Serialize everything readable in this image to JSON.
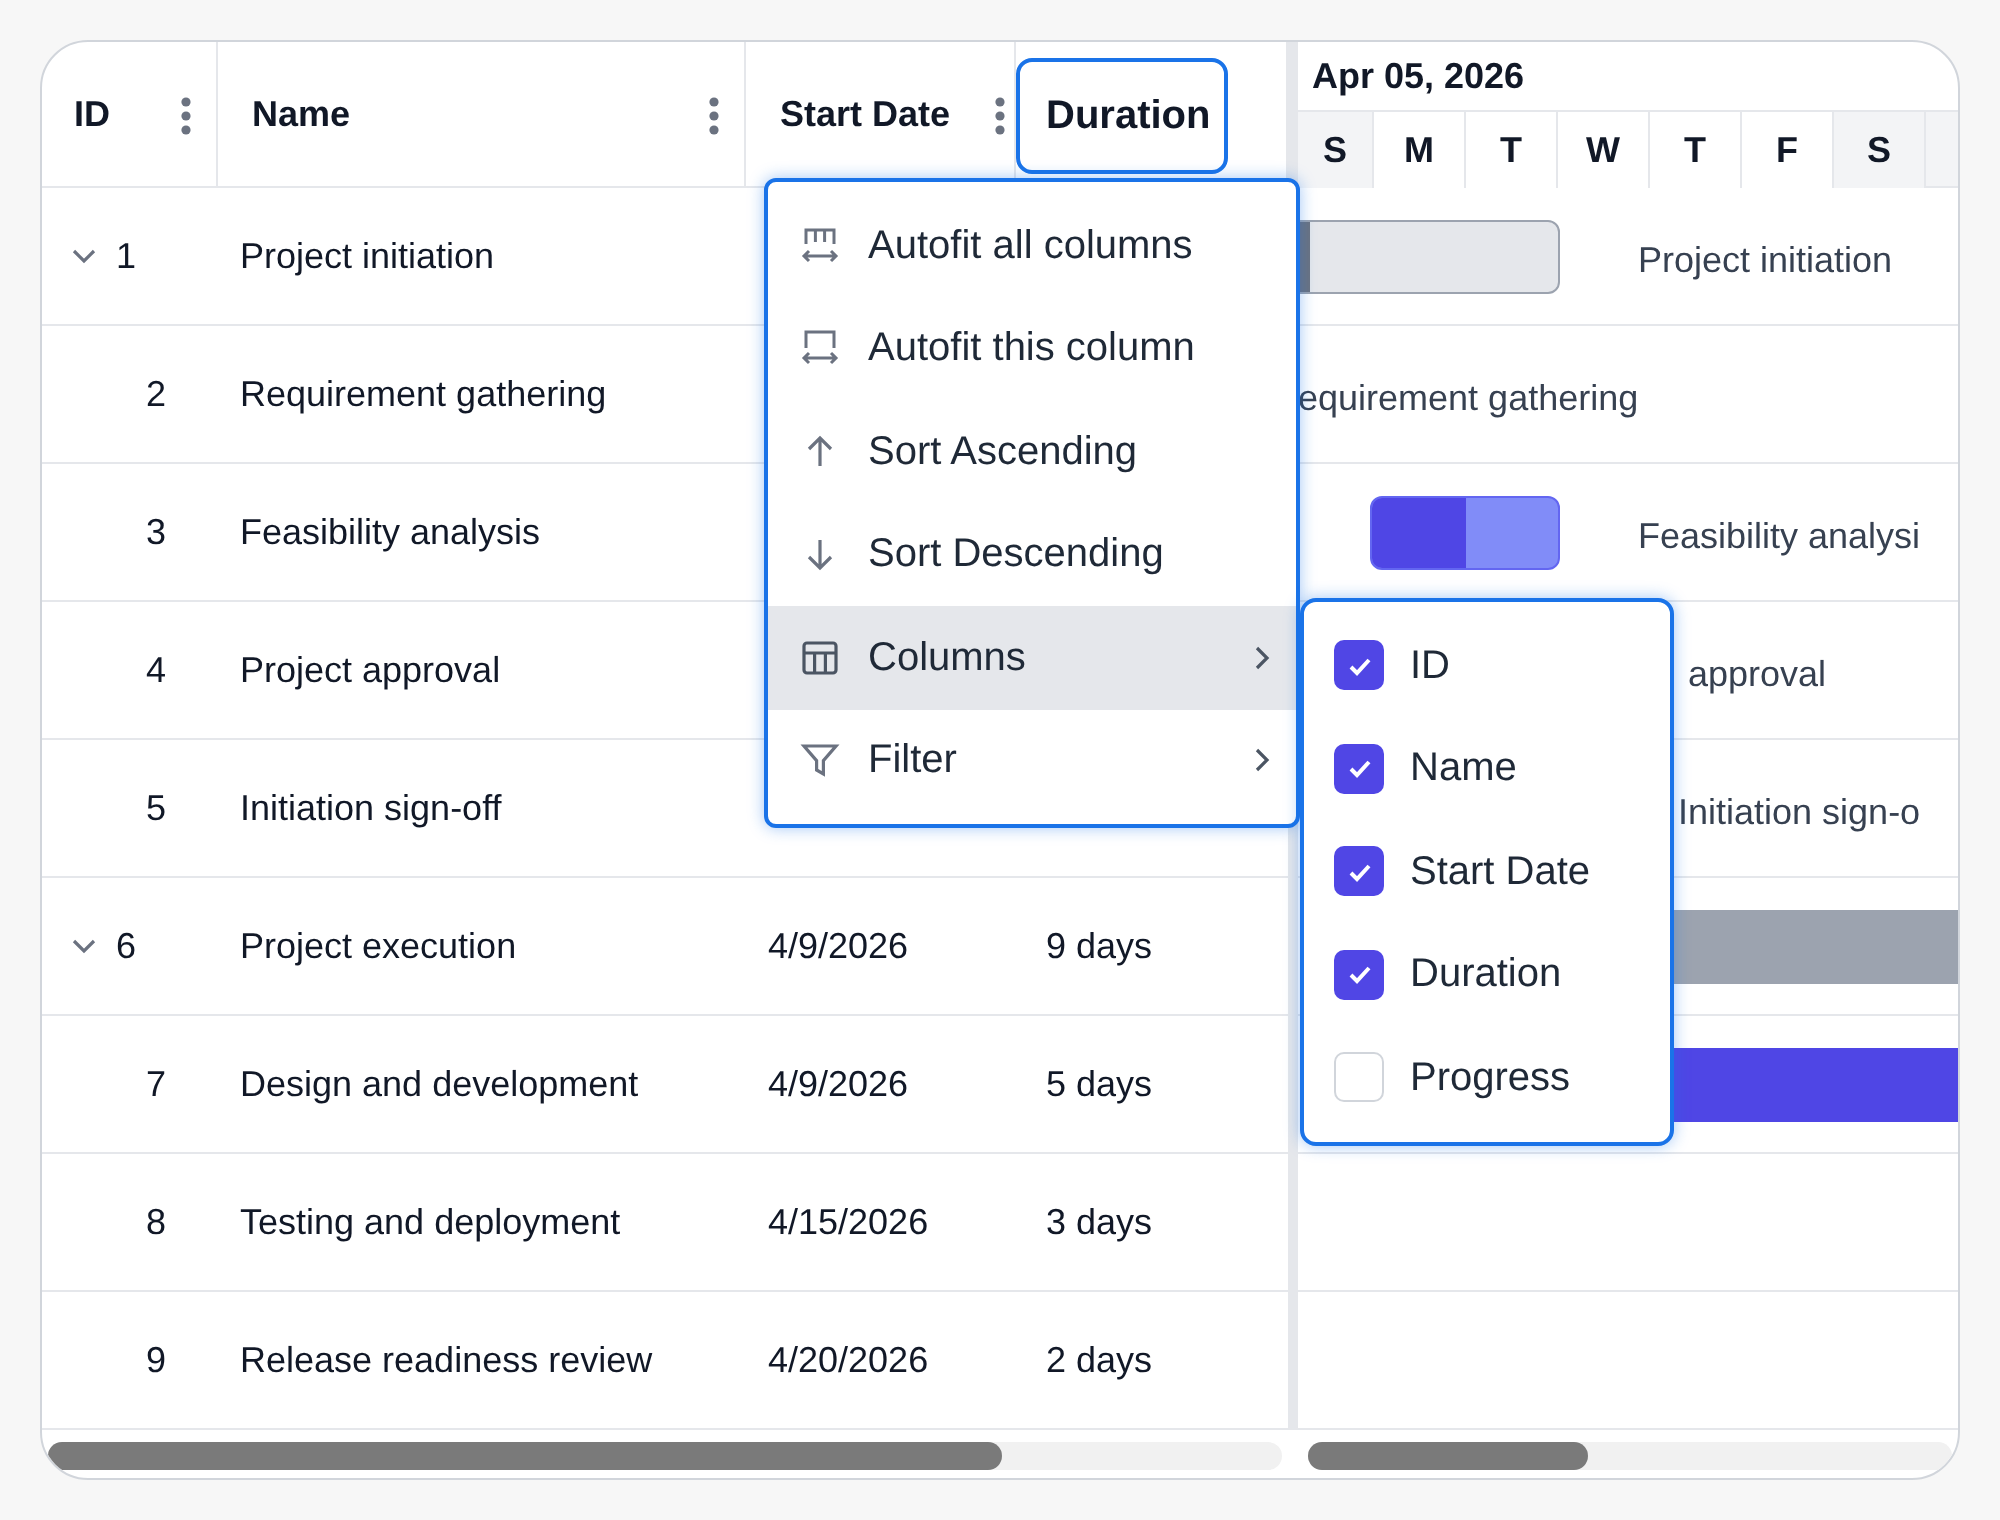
{
  "columns": [
    {
      "label": "ID",
      "selected": false
    },
    {
      "label": "Name",
      "selected": false
    },
    {
      "label": "Start Date",
      "selected": false
    },
    {
      "label": "Duration",
      "selected": true
    }
  ],
  "rows": [
    {
      "id": "1",
      "name": "Project initiation",
      "kind": "summary",
      "expanded": true
    },
    {
      "id": "2",
      "name": "Requirement gathering",
      "kind": "task"
    },
    {
      "id": "3",
      "name": "Feasibility analysis",
      "kind": "task"
    },
    {
      "id": "4",
      "name": "Project approval",
      "kind": "task"
    },
    {
      "id": "5",
      "name": "Initiation sign-off",
      "kind": "task"
    },
    {
      "id": "6",
      "name": "Project execution",
      "kind": "summary",
      "expanded": true,
      "start_date": "4/9/2026",
      "duration": "9 days"
    },
    {
      "id": "7",
      "name": "Design and development",
      "kind": "task",
      "start_date": "4/9/2026",
      "duration": "5 days"
    },
    {
      "id": "8",
      "name": "Testing and deployment",
      "kind": "task",
      "start_date": "4/15/2026",
      "duration": "3 days"
    },
    {
      "id": "9",
      "name": "Release readiness review",
      "kind": "task",
      "start_date": "4/20/2026",
      "duration": "2 days"
    }
  ],
  "timeline": {
    "title": "Apr 05, 2026",
    "days": [
      {
        "label": "S",
        "weekend": true
      },
      {
        "label": "M",
        "weekend": false
      },
      {
        "label": "T",
        "weekend": false
      },
      {
        "label": "W",
        "weekend": false
      },
      {
        "label": "T",
        "weekend": false
      },
      {
        "label": "F",
        "weekend": false
      },
      {
        "label": "S",
        "weekend": true
      }
    ]
  },
  "gantt_rows": [
    {
      "label": "Project initiation",
      "bar": {
        "kind": "summary",
        "level": 0.04
      }
    },
    {
      "label": "equirement gathering"
    },
    {
      "label": "Feasibility analysi",
      "bar": {
        "kind": "task",
        "level": 0.5
      }
    },
    {
      "label": "approval"
    },
    {
      "label": "Initiation sign-o"
    },
    {
      "bar": {
        "kind": "summary"
      }
    },
    {
      "bar": {
        "kind": "task"
      }
    }
  ],
  "column_menu": {
    "items": [
      {
        "label": "Autofit all columns",
        "submenu": false,
        "selected": false
      },
      {
        "label": "Autofit this column",
        "submenu": false,
        "selected": false
      },
      {
        "label": "Sort Ascending",
        "submenu": false,
        "selected": false
      },
      {
        "label": "Sort Descending",
        "submenu": false,
        "selected": false
      },
      {
        "label": "Columns",
        "submenu": true,
        "selected": true
      },
      {
        "label": "Filter",
        "submenu": true,
        "selected": false
      }
    ]
  },
  "columns_submenu": [
    {
      "label": "ID",
      "checked": true
    },
    {
      "label": "Name",
      "checked": true
    },
    {
      "label": "Start Date",
      "checked": true
    },
    {
      "label": "Duration",
      "checked": true
    },
    {
      "label": "Progress",
      "checked": false
    }
  ]
}
